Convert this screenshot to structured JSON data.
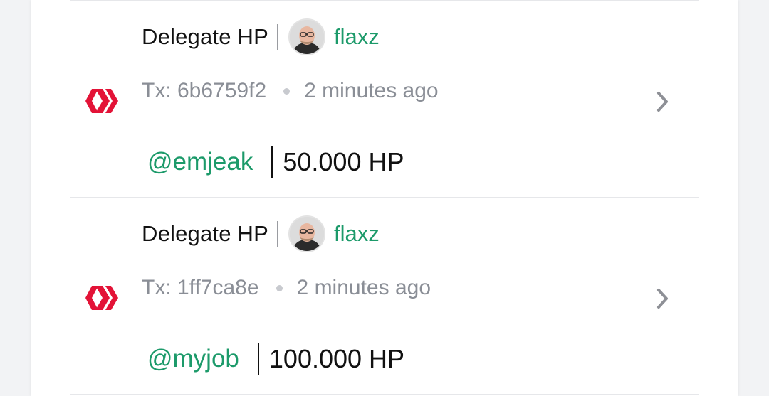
{
  "colors": {
    "accent_green": "#1c9a6a",
    "hive_red": "#e31337",
    "muted_text": "#8a8e96"
  },
  "transactions": [
    {
      "icon": "hive-logo-icon",
      "type": "Delegate HP",
      "author": "flaxz",
      "tx_label": "Tx: 6b6759f2",
      "time": "2 minutes ago",
      "recipient": "@emjeak",
      "amount": "50.000 HP"
    },
    {
      "icon": "hive-logo-icon",
      "type": "Delegate HP",
      "author": "flaxz",
      "tx_label": "Tx: 1ff7ca8e",
      "time": "2 minutes ago",
      "recipient": "@myjob",
      "amount": "100.000 HP"
    }
  ]
}
